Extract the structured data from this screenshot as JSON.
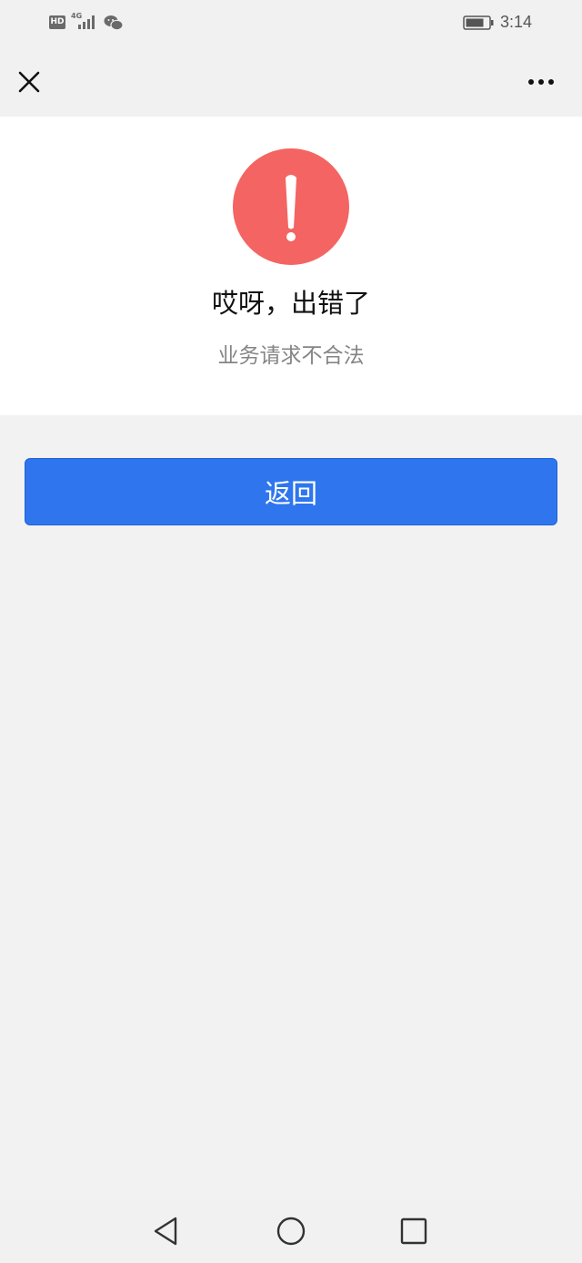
{
  "status_bar": {
    "hd_label": "HD",
    "network_label": "4G",
    "time": "3:14",
    "icons": [
      "signal-icon",
      "wechat-icon",
      "battery-icon"
    ]
  },
  "nav": {
    "icons": [
      "close-icon",
      "more-icon"
    ]
  },
  "error": {
    "icon": "warning-icon",
    "title": "哎呀，出错了",
    "message": "业务请求不合法"
  },
  "actions": {
    "back_label": "返回"
  },
  "system_nav": {
    "icons": [
      "back-triangle-icon",
      "home-circle-icon",
      "recents-square-icon"
    ]
  },
  "colors": {
    "accent": "#2f76ee",
    "warning": "#f46462",
    "background": "#f2f2f3"
  }
}
